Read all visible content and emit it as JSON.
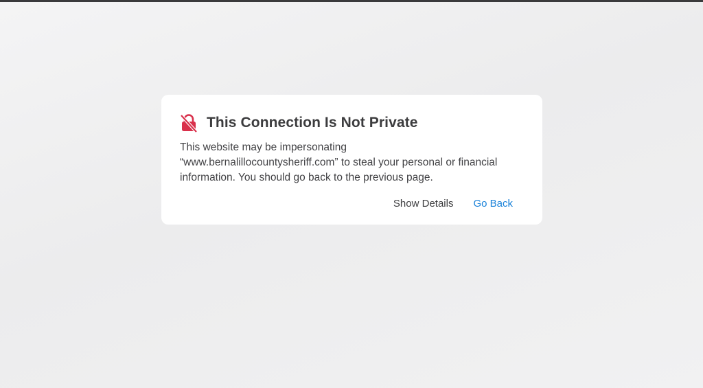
{
  "dialog": {
    "icon": "broken-lock-icon",
    "icon_color": "#d9304b",
    "title": "This Connection Is Not Private",
    "message_lines": [
      "This website may be impersonating",
      "“www.bernalillocountysheriff.com” to steal your personal or financial",
      "information. You should go back to the previous page."
    ],
    "show_details_label": "Show Details",
    "go_back_label": "Go Back",
    "link_color": "#1a82d9"
  }
}
